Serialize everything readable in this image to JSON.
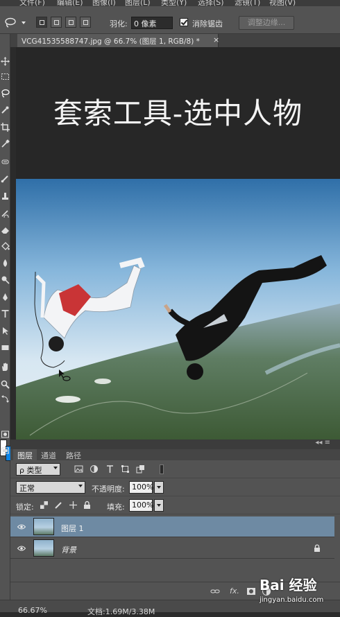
{
  "menubar": {
    "items": [
      "文件(F)",
      "编辑(E)",
      "图像(I)",
      "图层(L)",
      "类型(Y)",
      "选择(S)",
      "滤镜(T)",
      "视图(V)"
    ]
  },
  "options": {
    "feather_label": "羽化:",
    "feather_value": "0 像素",
    "antialias_label": "消除锯齿",
    "refine_edge_label": "调整边缘..."
  },
  "document": {
    "tab_title": "VCG41535588747.jpg @ 66.7% (图层 1, RGB/8) *",
    "close_glyph": "×"
  },
  "canvas": {
    "heading": "套索工具-选中人物"
  },
  "panel": {
    "tabs": [
      "图层",
      "通道",
      "路径"
    ],
    "collapse_glyph": "◂◂ ≡",
    "filter_kind": "ρ 类型",
    "blend_mode": "正常",
    "opacity_label": "不透明度:",
    "opacity_value": "100%",
    "lock_label": "锁定:",
    "fill_label": "填充:",
    "fill_value": "100%",
    "layers": [
      {
        "name": "图层 1",
        "selected": true
      },
      {
        "name": "背景",
        "selected": false,
        "locked": true
      }
    ],
    "bottom_fx": "fx."
  },
  "status": {
    "zoom": "66.67%",
    "doc_size": "文档:1.69M/3.38M"
  },
  "watermark": {
    "logo": "Bai 经验",
    "url": "jingyan.baidu.com"
  },
  "colors": {
    "foreground": "#ffffff",
    "background": "#0a84e8",
    "selected_layer": "#6e8aa3"
  }
}
